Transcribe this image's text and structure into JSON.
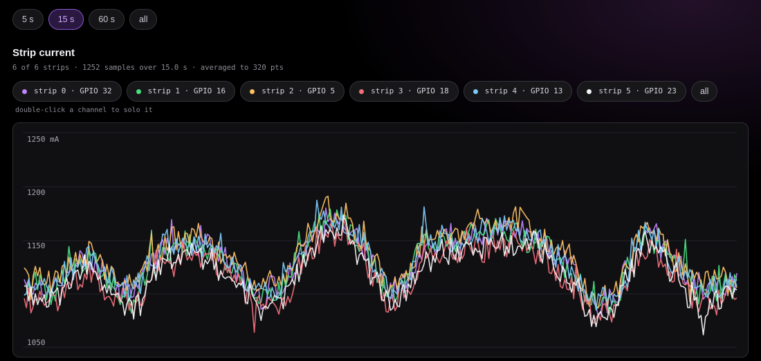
{
  "range_buttons": [
    {
      "label": "5 s",
      "active": false
    },
    {
      "label": "15 s",
      "active": true
    },
    {
      "label": "60 s",
      "active": false
    },
    {
      "label": "all",
      "active": false
    }
  ],
  "panel": {
    "title": "Strip current",
    "subtitle": "6 of 6 strips · 1252 samples over 15.0 s · averaged to 320 pts",
    "hint": "double-click a channel to solo it"
  },
  "channels": [
    {
      "label": "strip 0 · GPIO 32",
      "color": "#c084fc"
    },
    {
      "label": "strip 1 · GPIO 16",
      "color": "#4ade80"
    },
    {
      "label": "strip 2 · GPIO 5",
      "color": "#fcc062"
    },
    {
      "label": "strip 3 · GPIO 18",
      "color": "#f0707a"
    },
    {
      "label": "strip 4 · GPIO 13",
      "color": "#7cc8f8"
    },
    {
      "label": "strip 5 · GPIO 23",
      "color": "#f4f4f6"
    }
  ],
  "channels_all_label": "all",
  "chart_data": {
    "type": "line",
    "unit": "mA",
    "y_ticks": [
      "1250 mA",
      "1200",
      "1150",
      "1050"
    ],
    "ylim": [
      1050,
      1250
    ],
    "grid": true,
    "points_per_series": 320,
    "series": [
      {
        "name": "strip 0 · GPIO 32",
        "color": "#c084fc",
        "offset": 0
      },
      {
        "name": "strip 1 · GPIO 16",
        "color": "#4ade80",
        "offset": -2
      },
      {
        "name": "strip 2 · GPIO 5",
        "color": "#fcc062",
        "offset": 5
      },
      {
        "name": "strip 3 · GPIO 18",
        "color": "#f0707a",
        "offset": -14
      },
      {
        "name": "strip 4 · GPIO 13",
        "color": "#7cc8f8",
        "offset": 0
      },
      {
        "name": "strip 5 · GPIO 23",
        "color": "#f4f4f6",
        "offset": -12
      }
    ],
    "profile_x": [
      0,
      0.04,
      0.09,
      0.15,
      0.2,
      0.24,
      0.27,
      0.33,
      0.36,
      0.41,
      0.45,
      0.48,
      0.51,
      0.54,
      0.56,
      0.6,
      0.64,
      0.7,
      0.76,
      0.8,
      0.83,
      0.87,
      0.9,
      0.95,
      1.0
    ],
    "profile_y": [
      1112,
      1105,
      1135,
      1100,
      1145,
      1152,
      1140,
      1100,
      1105,
      1165,
      1168,
      1145,
      1100,
      1115,
      1150,
      1148,
      1158,
      1160,
      1132,
      1090,
      1098,
      1160,
      1140,
      1100,
      1112
    ]
  }
}
